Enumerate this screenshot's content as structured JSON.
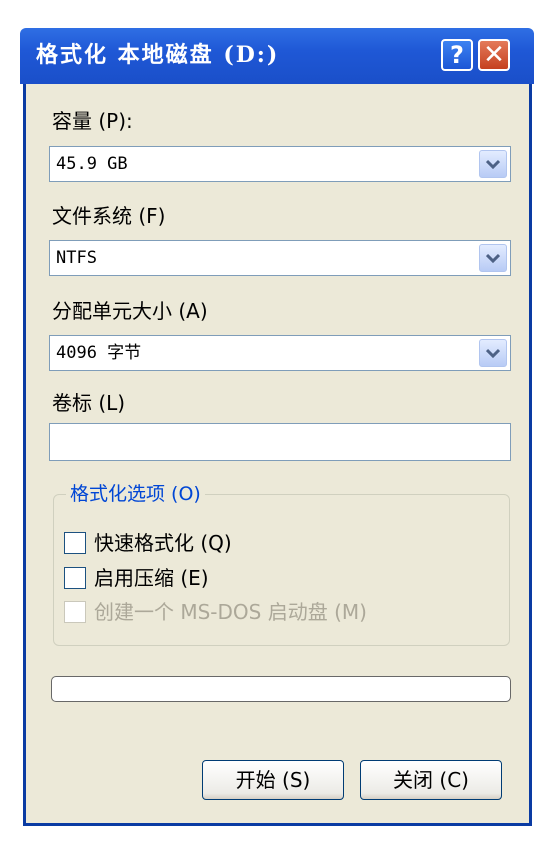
{
  "window": {
    "title": "格式化 本地磁盘 (D:)",
    "help_icon": "help-icon",
    "close_icon": "close-icon"
  },
  "capacity": {
    "label": "容量 (P):",
    "value": "45.9 GB"
  },
  "file_system": {
    "label": "文件系统 (F)",
    "value": "NTFS"
  },
  "allocation_unit": {
    "label": "分配单元大小 (A)",
    "value": "4096 字节"
  },
  "volume_label": {
    "label": "卷标 (L)",
    "value": ""
  },
  "format_options": {
    "title": "格式化选项 (O)",
    "quick_format": {
      "label": "快速格式化 (Q)",
      "checked": false
    },
    "enable_compression": {
      "label": "启用压缩 (E)",
      "checked": false
    },
    "ms_dos_startup": {
      "label": "创建一个 MS-DOS 启动盘 (M)",
      "checked": false,
      "disabled": true
    }
  },
  "progress": {
    "value": 0
  },
  "buttons": {
    "start": "开始 (S)",
    "close": "关闭 (C)"
  }
}
